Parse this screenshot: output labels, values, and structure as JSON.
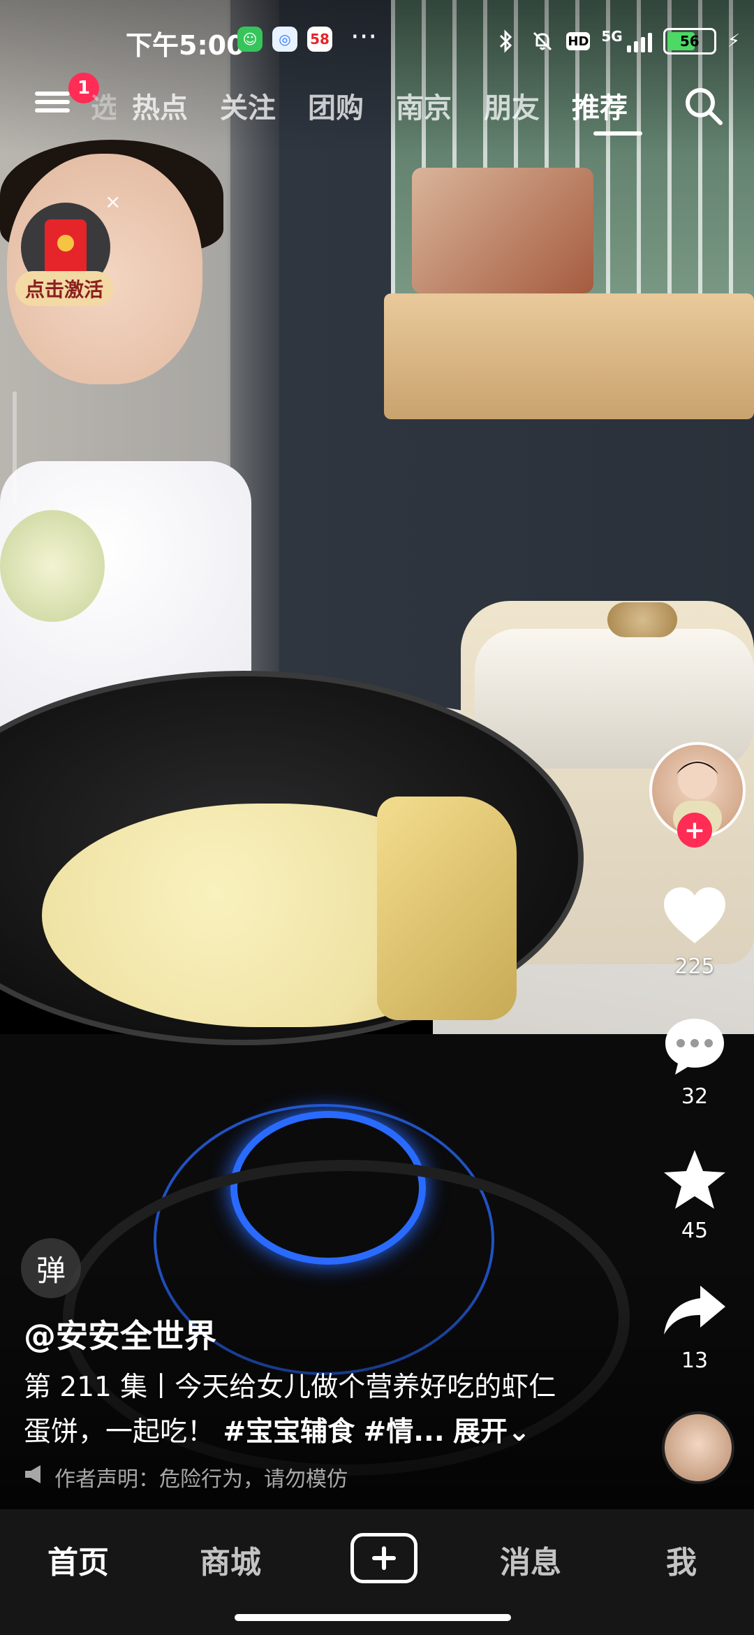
{
  "status_bar": {
    "time": "下午5:00",
    "app_icons": [
      "green-app-icon",
      "blue-app-icon",
      "58-app-icon"
    ],
    "more": "···",
    "network": "5G",
    "battery_percent": "56"
  },
  "top_nav": {
    "badge_count": "1",
    "tabs": [
      "选",
      "热点",
      "关注",
      "团购",
      "南京",
      "朋友",
      "推荐"
    ],
    "active_tab": "推荐"
  },
  "red_packet": {
    "label": "点击激活",
    "close": "×"
  },
  "rail": {
    "follow_plus": "+",
    "likes": "225",
    "comments": "32",
    "favorites": "45",
    "shares": "13"
  },
  "danmu_label": "弹",
  "caption": {
    "author": "@安安全世界",
    "line1": "第 211 集丨今天给女儿做个营养好吃的虾仁",
    "line2_text": "蛋饼，一起吃！",
    "tag1": "#宝宝辅食",
    "tag2": "#情...",
    "expand": "展开",
    "disclaimer": "作者声明：危险行为，请勿模仿"
  },
  "bottom_nav": {
    "items": [
      "首页",
      "商城",
      "消息",
      "我"
    ],
    "active": "首页"
  },
  "colors": {
    "accent": "#ff2c55",
    "battery": "#4cd964",
    "nav_bg": "#161616"
  }
}
